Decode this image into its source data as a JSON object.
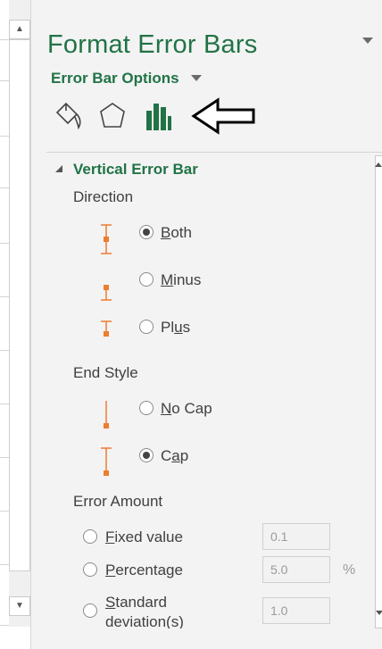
{
  "pane": {
    "title": "Format Error Bars",
    "options_label": "Error Bar Options",
    "tabs": [
      {
        "name": "fill-line-tab",
        "icon": "paint-bucket-icon"
      },
      {
        "name": "effects-tab",
        "icon": "pentagon-icon"
      },
      {
        "name": "error-bar-options-tab",
        "icon": "bar-chart-icon",
        "selected": true
      }
    ]
  },
  "section": {
    "title": "Vertical Error Bar",
    "direction_label": "Direction",
    "direction_options": [
      {
        "label_u": "B",
        "label_rest": "oth",
        "checked": true
      },
      {
        "label_u": "M",
        "label_rest": "inus",
        "checked": false
      },
      {
        "label_pre": "Pl",
        "label_u": "u",
        "label_rest": "s",
        "checked": false
      }
    ],
    "end_style_label": "End Style",
    "end_style_options": [
      {
        "label_u": "N",
        "label_rest": "o Cap",
        "checked": false
      },
      {
        "label_pre": "C",
        "label_u": "a",
        "label_rest": "p",
        "checked": true
      }
    ],
    "error_amount_label": "Error Amount",
    "error_amount_options": [
      {
        "label_u": "F",
        "label_rest": "ixed value",
        "value": "0.1",
        "checked": false
      },
      {
        "label_u": "P",
        "label_rest": "ercentage",
        "value": "5.0",
        "suffix": "%",
        "checked": false
      },
      {
        "label_u": "S",
        "label_rest": "tandard",
        "label_line2": "deviation(s)",
        "value": "1.0",
        "checked": false
      }
    ]
  },
  "colors": {
    "accent_green": "#217346",
    "error_bar_orange": "#ed7d31"
  }
}
